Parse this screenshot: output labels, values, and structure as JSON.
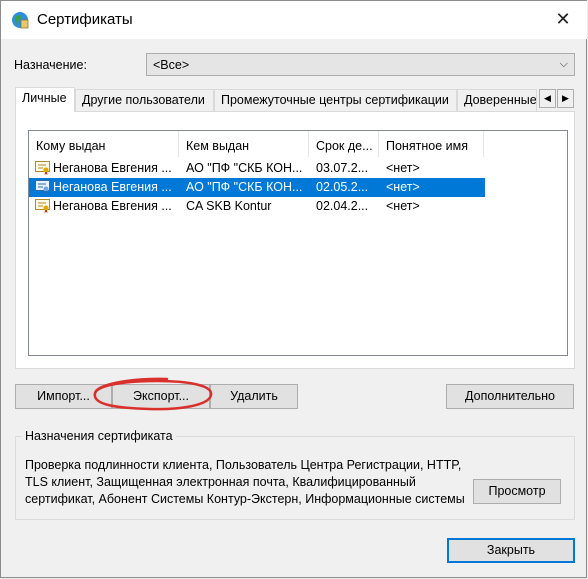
{
  "window": {
    "title": "Сертификаты",
    "close_glyph": "✕"
  },
  "purpose": {
    "label": "Назначение:",
    "value": "<Все>",
    "arrow": "⌵"
  },
  "tabs": [
    {
      "label": "Личные",
      "active": true
    },
    {
      "label": "Другие пользователи"
    },
    {
      "label": "Промежуточные центры сертификации"
    },
    {
      "label": "Доверенные"
    }
  ],
  "tab_scroll": {
    "left": "◀",
    "right": "▶"
  },
  "columns": [
    "Кому выдан",
    "Кем выдан",
    "Срок де...",
    "Понятное имя"
  ],
  "rows": [
    {
      "issued_to": "Неганова Евгения ...",
      "issued_by": "АО \"ПФ \"СКБ КОН...",
      "expires": "03.07.2...",
      "friendly": "<нет>",
      "selected": false
    },
    {
      "issued_to": "Неганова Евгения ...",
      "issued_by": "АО \"ПФ \"СКБ КОН...",
      "expires": "02.05.2...",
      "friendly": "<нет>",
      "selected": true
    },
    {
      "issued_to": "Неганова Евгения ...",
      "issued_by": "CA SKB Kontur",
      "expires": "02.04.2...",
      "friendly": "<нет>",
      "selected": false
    }
  ],
  "buttons": {
    "import": "Импорт...",
    "export": "Экспорт...",
    "delete": "Удалить",
    "advanced": "Дополнительно",
    "view": "Просмотр",
    "close": "Закрыть"
  },
  "purposes_group": {
    "title": "Назначения сертификата",
    "lines": [
      "Проверка подлинности клиента, Пользователь Центра Регистрации, HTTP,",
      "TLS клиент, Защищенная электронная почта, Квалифицированный",
      "сертификат, Абонент Системы Контур-Экстерн, Информационные системы"
    ]
  },
  "colors": {
    "selection": "#0078d7",
    "annotation": "#d9302c"
  }
}
